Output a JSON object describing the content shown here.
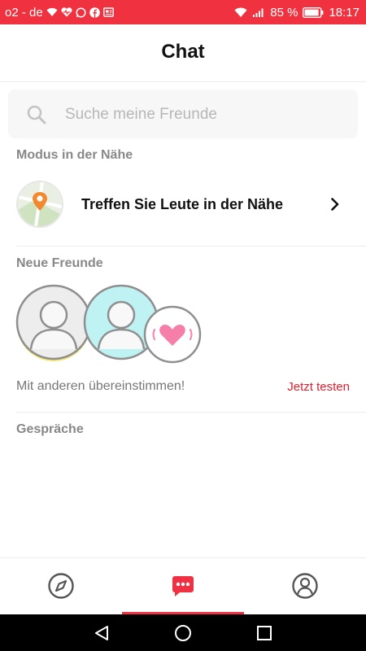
{
  "status_bar": {
    "carrier": "o2 - de",
    "battery": "85 %",
    "time": "18:17",
    "background": "#f0313f"
  },
  "header": {
    "title": "Chat"
  },
  "search": {
    "placeholder": "Suche meine Freunde",
    "icon": "search-icon"
  },
  "nearby": {
    "section_label": "Modus in der Nähe",
    "item_label": "Treffen Sie Leute in der Nähe",
    "icon": "map-pin-icon"
  },
  "new_friends": {
    "section_label": "Neue Freunde",
    "match_text": "Mit anderen übereinstimmen!",
    "try_link": "Jetzt testen",
    "link_color": "#e0202e"
  },
  "conversations": {
    "section_label": "Gespräche"
  },
  "bottom_nav": {
    "items": [
      {
        "icon": "compass-icon"
      },
      {
        "icon": "chat-icon",
        "active": true
      },
      {
        "icon": "profile-icon"
      }
    ],
    "accent": "#ee3244"
  }
}
